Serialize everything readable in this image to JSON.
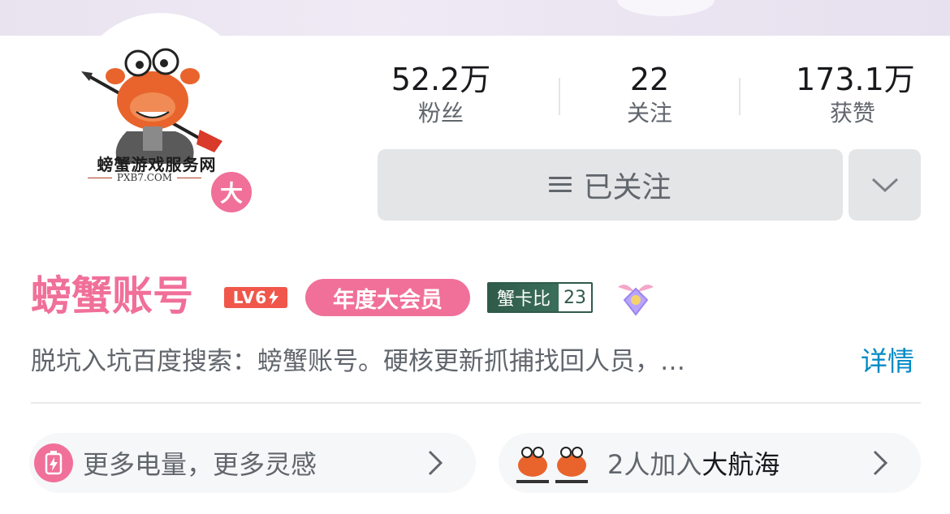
{
  "profile": {
    "avatar_text": "螃蟹游戏服务网",
    "avatar_subtext": "PXB7.COM",
    "big_member_badge": "大",
    "name": "螃蟹账号",
    "level": "LV6",
    "vip_label": "年度大会员",
    "medal": {
      "name": "蟹卡比",
      "level": "23"
    },
    "signature": "脱坑入坑百度搜索：螃蟹账号。硬核更新抓捕找回人员，…",
    "detail_link": "详情"
  },
  "stats": {
    "fans_count": "52.2万",
    "fans_label": "粉丝",
    "following_count": "22",
    "following_label": "关注",
    "likes_count": "173.1万",
    "likes_label": "获赞"
  },
  "actions": {
    "followed_label": "已关注"
  },
  "cards": {
    "power_text": "更多电量，更多灵感",
    "fleet_prefix": "2人加入",
    "fleet_name": "大航海"
  },
  "colors": {
    "accent_pink": "#f0709a",
    "link_blue": "#008ac5",
    "level_red": "#f0574a",
    "medal_green": "#2f5a4a"
  },
  "icons": [
    "crab-avatar",
    "menu-icon",
    "chevron-down-icon",
    "lightning-icon",
    "chevron-right-icon",
    "pendant-icon"
  ]
}
